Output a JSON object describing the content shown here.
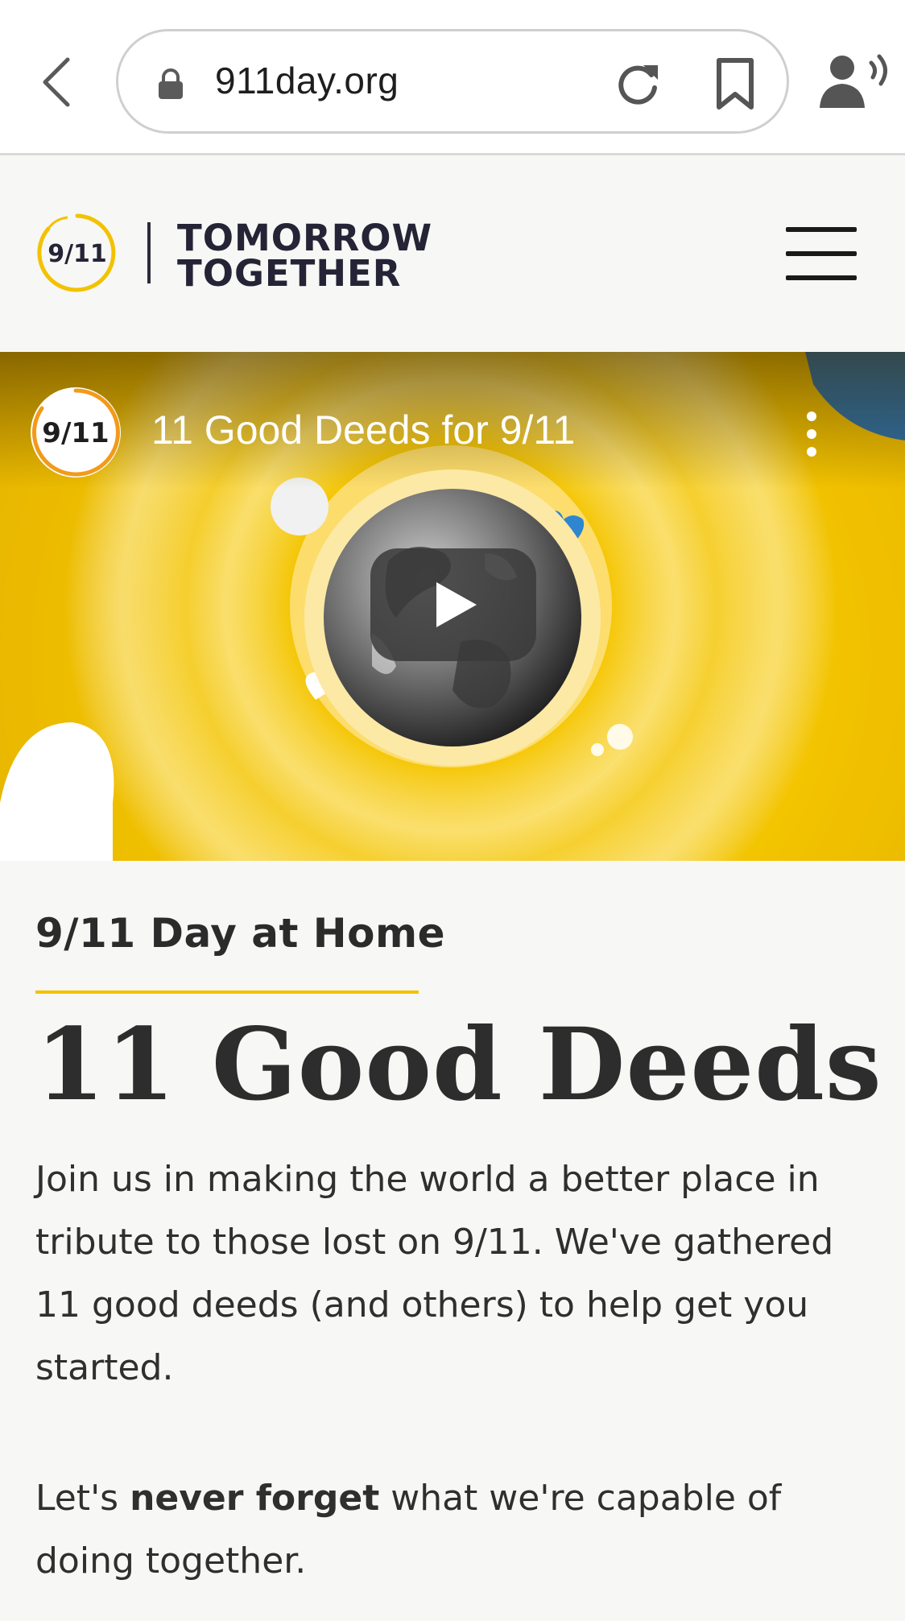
{
  "browser": {
    "url": "911day.org",
    "icons": [
      "back-arrow-icon",
      "lock-icon",
      "reload-icon",
      "bookmark-icon",
      "speaker-icon"
    ]
  },
  "header": {
    "logo_badge": "9/11",
    "wordmark_line1": "TOMORROW",
    "wordmark_line2": "TOGETHER",
    "menu_icon": "hamburger-menu-icon",
    "accent_color": "#f2c200"
  },
  "video": {
    "channel_badge": "9/11",
    "title": "11 Good Deeds for 9/11",
    "icons": [
      "play-icon",
      "more-vertical-icon",
      "earth-image"
    ],
    "background_color": "#f3c400"
  },
  "content": {
    "eyebrow": "9/11 Day at Home",
    "headline": "11 Good Deeds",
    "intro": "Join us in making the world a better place in tribute to those lost on 9/11. We've gathered 11 good deeds (and others) to help get you started.",
    "tagline_before": "Let's ",
    "tagline_bold": "never forget",
    "tagline_after": " what we're capable of doing together."
  }
}
